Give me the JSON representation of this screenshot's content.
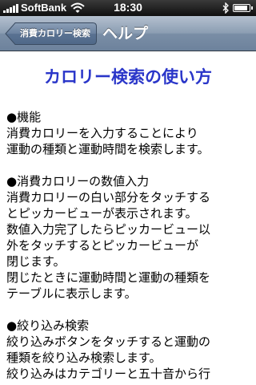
{
  "status_bar": {
    "carrier": "SoftBank",
    "time": "18:30",
    "battery_level": 0.9
  },
  "nav_bar": {
    "back_label": "消費カロリー検索",
    "title": "ヘルプ"
  },
  "page": {
    "heading": "カロリー検索の使い方",
    "heading_color": "#2a36c9",
    "sections": [
      {
        "title": "●機能",
        "lines": [
          "消費カロリーを入力することにより",
          "運動の種類と運動時間を検索します。"
        ]
      },
      {
        "title": "●消費カロリーの数値入力",
        "lines": [
          "消費カロリーの白い部分をタッチする",
          "とピッカービューが表示されます。",
          "数値入力完了したらピッカービュー以",
          "外をタッチするとピッカービューが",
          "閉じます。",
          "閉じたときに運動時間と運動の種類を",
          "テーブルに表示します。"
        ]
      },
      {
        "title": "●絞り込み検索",
        "lines": [
          "絞り込みボタンをタッチすると運動の",
          "種類を絞り込み検索します。",
          "絞り込みはカテゴリーと五十音から行"
        ]
      }
    ]
  }
}
